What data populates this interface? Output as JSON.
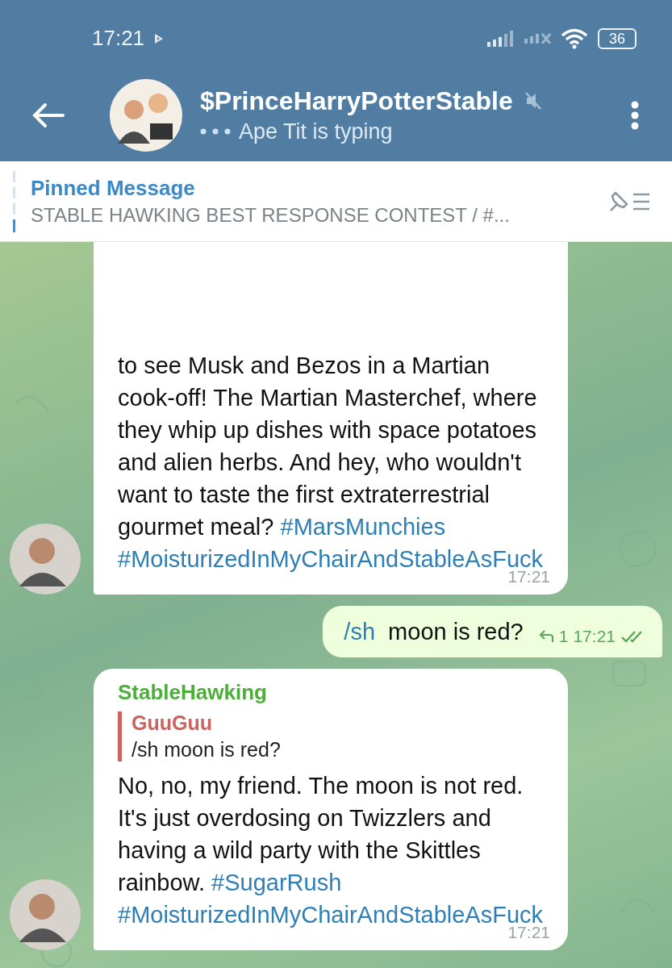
{
  "status_bar": {
    "time": "17:21",
    "battery": "36"
  },
  "header": {
    "title": "$PrinceHarryPotterStable",
    "muted": true,
    "typing": "Ape Tit is typing"
  },
  "pinned": {
    "label": "Pinned Message",
    "text": "STABLE HAWKING BEST RESPONSE CONTEST / #..."
  },
  "messages": [
    {
      "kind": "incoming",
      "continued": true,
      "parts": [
        {
          "kind": "text",
          "text": "to see Musk and Bezos in a Martian cook-off! The Martian Masterchef, where they whip up dishes with space potatoes and alien herbs. And hey, who wouldn't want to taste the first extraterrestrial gourmet meal? "
        },
        {
          "kind": "hashtag",
          "text": "#MarsMunchies"
        },
        {
          "kind": "hashtag",
          "text": "#MoisturizedInMyChairAndStableAsFuck"
        }
      ],
      "time": "17:21"
    },
    {
      "kind": "outgoing",
      "parts": [
        {
          "kind": "command",
          "text": "/sh"
        },
        {
          "kind": "text",
          "text": " moon is red?"
        }
      ],
      "replies": "1",
      "time": "17:21",
      "read": true
    },
    {
      "kind": "incoming",
      "sender": "StableHawking",
      "reply": {
        "author": "GuuGuu",
        "text": "/sh moon is red?"
      },
      "parts": [
        {
          "kind": "text",
          "text": "No, no, my friend. The moon is not red. It's just overdosing on Twizzlers and having a wild party with the Skittles rainbow. "
        },
        {
          "kind": "hashtag",
          "text": "#SugarRush"
        },
        {
          "kind": "hashtag",
          "text": "#MoisturizedInMyChairAndStableAsFuck"
        }
      ],
      "time": "17:21"
    }
  ]
}
